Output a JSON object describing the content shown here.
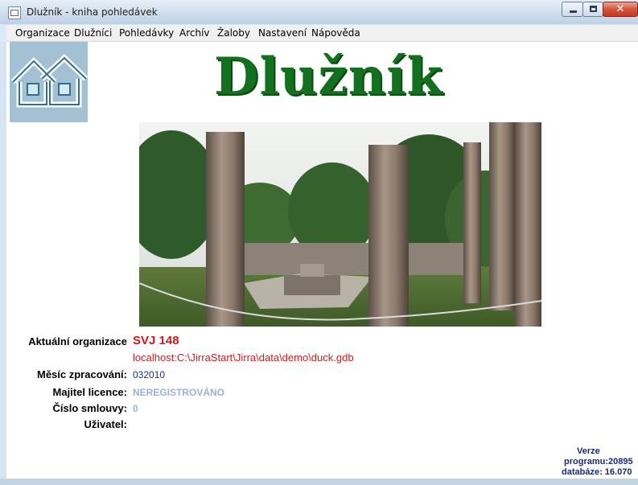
{
  "window": {
    "title": "Dlužník - kniha pohledávek",
    "controls": {
      "close_glyph": "✕"
    }
  },
  "menu": [
    "Organizace",
    "Dlužníci",
    "Pohledávky",
    "Archív",
    "Žaloby",
    "Nastavení",
    "Nápověda"
  ],
  "heading": "Dlužník",
  "info": {
    "organization_label": "Aktuální organizace",
    "organization_value": "SVJ 148",
    "database_path": "localhost:C:\\JirraStart\\Jirra\\data\\demo\\duck.gdb",
    "month_label": "Měsíc zpracování:",
    "month_value": "032010",
    "licence_label": "Majitel licence:",
    "licence_value": "NEREGISTROVÁNO",
    "contract_label": "Číslo smlouvy:",
    "contract_value": "0",
    "user_label": "Uživatel:"
  },
  "version": {
    "line1": "Verze",
    "line2": "programu:20895",
    "line3": "databáze: 16.070"
  },
  "colors": {
    "heading": "#12701f",
    "organization": "#d01818",
    "database_path": "#c42020",
    "month": "#1f2f8e",
    "licence": "#9bb2cc",
    "version": "#1a2a70"
  }
}
